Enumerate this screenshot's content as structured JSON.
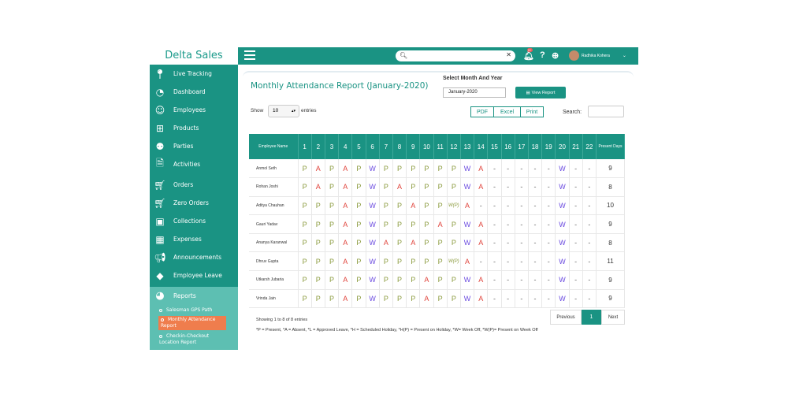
{
  "brand": "Delta Sales",
  "sidebar": {
    "items": [
      {
        "label": "Live Tracking",
        "icon": "location-pin-icon"
      },
      {
        "label": "Dashboard",
        "icon": "dashboard-gauge-icon"
      },
      {
        "label": "Employees",
        "icon": "user-icon"
      },
      {
        "label": "Products",
        "icon": "grid-icon"
      },
      {
        "label": "Parties",
        "icon": "group-icon"
      },
      {
        "label": "Activities",
        "icon": "document-icon"
      },
      {
        "label": "Orders",
        "icon": "cart-icon"
      },
      {
        "label": "Zero Orders",
        "icon": "cart-icon"
      },
      {
        "label": "Collections",
        "icon": "money-icon"
      },
      {
        "label": "Expenses",
        "icon": "blocks-icon"
      },
      {
        "label": "Announcements",
        "icon": "megaphone-icon"
      },
      {
        "label": "Employee Leave",
        "icon": "tag-icon"
      }
    ],
    "reports": {
      "label": "Reports",
      "icon": "pie-chart-icon"
    },
    "subitems": [
      "Salesman GPS Path",
      "Monthly Attendance Report",
      "Checkin-Checkout Location Report"
    ]
  },
  "topbar": {
    "notifications_count": "9+",
    "user_name": "Radhika Kohera"
  },
  "page": {
    "title": "Monthly Attendance Report (January-2020)",
    "select_label": "Select Month And Year",
    "month_value": "January-2020",
    "view_button": "View Report",
    "show_label": "Show",
    "show_value": "10",
    "entries_label": "entries",
    "export": [
      "PDF",
      "Excel",
      "Print"
    ],
    "search_label": "Search:"
  },
  "table": {
    "employee_header": "Employee Name",
    "present_header": "Present Days",
    "days": [
      "1",
      "2",
      "3",
      "4",
      "5",
      "6",
      "7",
      "8",
      "9",
      "10",
      "11",
      "12",
      "13",
      "14",
      "15",
      "16",
      "17",
      "18",
      "19",
      "20",
      "21",
      "22"
    ],
    "rows": [
      {
        "name": "Anmol Seth",
        "marks": [
          "P",
          "A",
          "P",
          "A",
          "P",
          "W",
          "P",
          "P",
          "P",
          "P",
          "P",
          "P",
          "W",
          "A",
          "-",
          "-",
          "-",
          "-",
          "-",
          "W",
          "-",
          "-"
        ],
        "present": "9"
      },
      {
        "name": "Rohan Joshi",
        "marks": [
          "P",
          "A",
          "P",
          "A",
          "P",
          "W",
          "P",
          "A",
          "P",
          "P",
          "P",
          "P",
          "W",
          "A",
          "-",
          "-",
          "-",
          "-",
          "-",
          "W",
          "-",
          "-"
        ],
        "present": "8"
      },
      {
        "name": "Aditya Chauhan",
        "marks": [
          "P",
          "P",
          "P",
          "A",
          "P",
          "W",
          "P",
          "P",
          "A",
          "P",
          "P",
          "W(P)",
          "A",
          "-",
          "-",
          "-",
          "-",
          "-",
          "-",
          "W",
          "-",
          "-"
        ],
        "present": "10"
      },
      {
        "name": "Gauri Yadav",
        "marks": [
          "P",
          "P",
          "P",
          "A",
          "P",
          "W",
          "P",
          "P",
          "P",
          "P",
          "A",
          "P",
          "W",
          "A",
          "-",
          "-",
          "-",
          "-",
          "-",
          "W",
          "-",
          "-"
        ],
        "present": "9"
      },
      {
        "name": "Ananya Karanwal",
        "marks": [
          "P",
          "P",
          "P",
          "A",
          "P",
          "W",
          "A",
          "P",
          "A",
          "P",
          "P",
          "P",
          "W",
          "A",
          "-",
          "-",
          "-",
          "-",
          "-",
          "W",
          "-",
          "-"
        ],
        "present": "8"
      },
      {
        "name": "Dhruv Gupta",
        "marks": [
          "P",
          "P",
          "P",
          "A",
          "P",
          "W",
          "P",
          "P",
          "P",
          "P",
          "P",
          "W(P)",
          "A",
          "-",
          "-",
          "-",
          "-",
          "-",
          "-",
          "W",
          "-",
          "-"
        ],
        "present": "11"
      },
      {
        "name": "Utkarsh Jubaria",
        "marks": [
          "P",
          "P",
          "P",
          "A",
          "P",
          "W",
          "P",
          "P",
          "P",
          "A",
          "P",
          "P",
          "W",
          "A",
          "-",
          "-",
          "-",
          "-",
          "-",
          "W",
          "-",
          "-"
        ],
        "present": "9"
      },
      {
        "name": "Vrinda Jain",
        "marks": [
          "P",
          "P",
          "P",
          "A",
          "P",
          "W",
          "P",
          "P",
          "P",
          "A",
          "P",
          "P",
          "W",
          "A",
          "-",
          "-",
          "-",
          "-",
          "-",
          "W",
          "-",
          "-"
        ],
        "present": "9"
      }
    ]
  },
  "footer": {
    "showing": "Showing 1 to 8 of 8 entries",
    "previous": "Previous",
    "page": "1",
    "next": "Next",
    "legend": "*P = Present, *A = Absent, *L = Approved Leave, *H = Scheduled Holiday, *H(P) = Present on Holiday, *W= Week Off, *W(P)= Present on Week Off"
  }
}
